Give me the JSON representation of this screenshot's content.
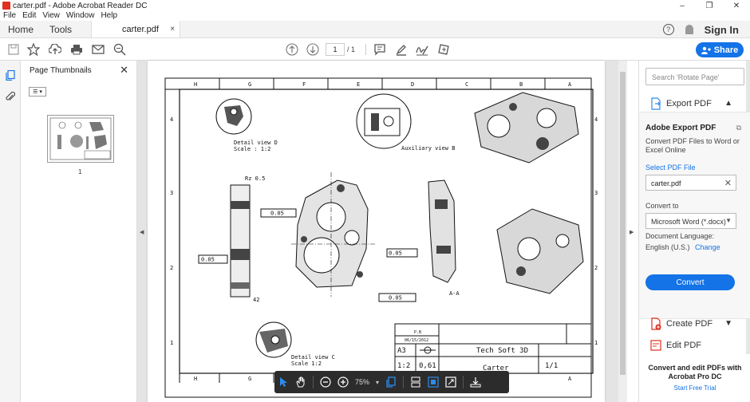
{
  "window": {
    "title": "carter.pdf - Adobe Acrobat Reader DC",
    "controls": [
      "–",
      "❐",
      "✕"
    ]
  },
  "menu": [
    "File",
    "Edit",
    "View",
    "Window",
    "Help"
  ],
  "tabs": {
    "home": "Home",
    "tools": "Tools",
    "document": "carter.pdf",
    "close": "×"
  },
  "header_right": {
    "help": "?",
    "signin": "Sign In"
  },
  "toolbar": {
    "page_current": "1",
    "page_total": "/ 1",
    "share": "Share"
  },
  "thumbnails": {
    "title": "Page Thumbnails",
    "close": "✕",
    "page_label": "1"
  },
  "drawing": {
    "col_letters_top": [
      "H",
      "G",
      "F",
      "E",
      "D",
      "C",
      "B",
      "A"
    ],
    "col_letters_bottom": [
      "H",
      "G",
      "B",
      "A"
    ],
    "row_numbers": [
      "4",
      "3",
      "2",
      "1"
    ],
    "detail_d": "Detail view D",
    "detail_d_scale": "Scale :  1:2",
    "auxiliary_b": "Auxiliary view B",
    "detail_c": "Detail view C",
    "detail_c_scale": "Scale 1:2",
    "section_label": "A-A",
    "tb_format": "A3",
    "tb_company": "Tech Soft 3D",
    "tb_scale": "1:2",
    "tb_weight": "0,61",
    "tb_part": "Carter",
    "tb_sheet": "1/1",
    "tb_author": "P.B",
    "tb_date": "06/15/2012",
    "tol_1": "0.05",
    "tol_2": "0.05",
    "tol_3": "0.05",
    "tol_4": "0.05",
    "dim_42": "42",
    "dim_rz": "Rz 0.5"
  },
  "float_toolbar": {
    "zoom": "75%"
  },
  "right_panel": {
    "search_placeholder": "Search 'Rotate Page'",
    "export_label": "Export PDF",
    "export_heading": "Adobe Export PDF",
    "export_desc": "Convert PDF Files to Word or Excel Online",
    "select_file": "Select PDF File",
    "file_name": "carter.pdf",
    "convert_to": "Convert to",
    "format": "Microsoft Word (*.docx)",
    "doc_lang_label": "Document Language:",
    "doc_lang": "English (U.S.)",
    "change": "Change",
    "convert_btn": "Convert",
    "create_pdf": "Create PDF",
    "edit_pdf": "Edit PDF",
    "promo": "Convert and edit PDFs with Acrobat Pro DC",
    "trial": "Start Free Trial"
  },
  "colors": {
    "accent": "#1473e6",
    "pdf_red": "#e0301e"
  }
}
